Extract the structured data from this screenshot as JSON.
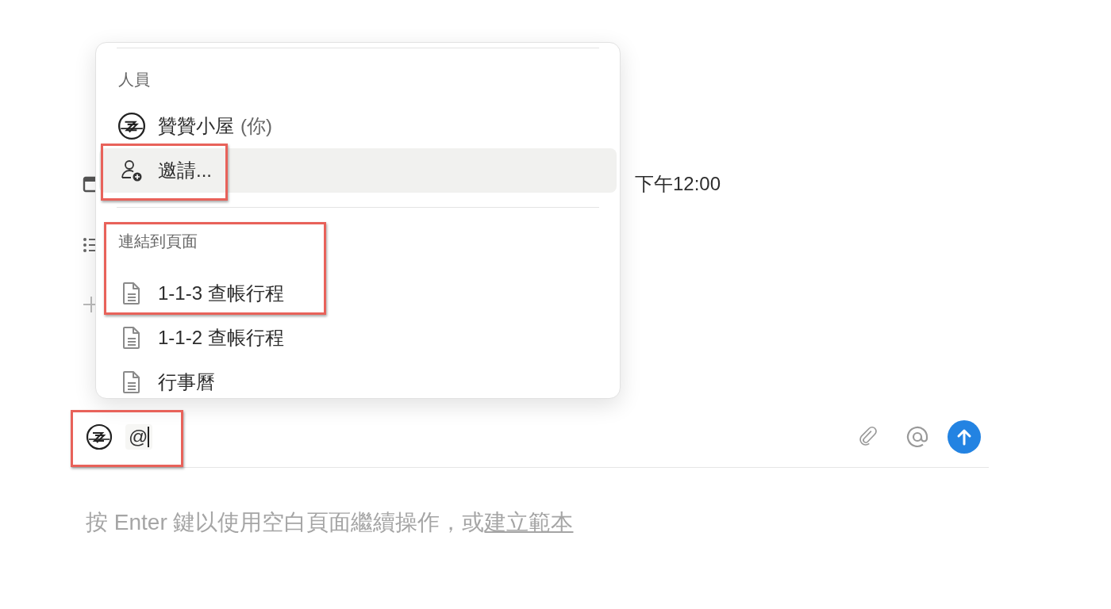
{
  "page": {
    "date_value": "下午12:00"
  },
  "mention_menu": {
    "sections": [
      {
        "header": "人員",
        "items": [
          {
            "kind": "user",
            "label": "贊贊小屋",
            "suffix": "(你)",
            "selected": false
          },
          {
            "kind": "invite",
            "label": "邀請...",
            "selected": true
          }
        ]
      },
      {
        "header": "連結到頁面",
        "items": [
          {
            "kind": "page",
            "label": "1-1-3 查帳行程",
            "selected": false
          },
          {
            "kind": "page",
            "label": "1-1-2 查帳行程",
            "selected": false
          },
          {
            "kind": "page",
            "label": "行事曆",
            "selected": false
          }
        ]
      }
    ]
  },
  "comment_box": {
    "value": "@"
  },
  "hint": {
    "text": "按 Enter 鍵以使用空白頁面繼續操作，或",
    "link": "建立範本"
  }
}
